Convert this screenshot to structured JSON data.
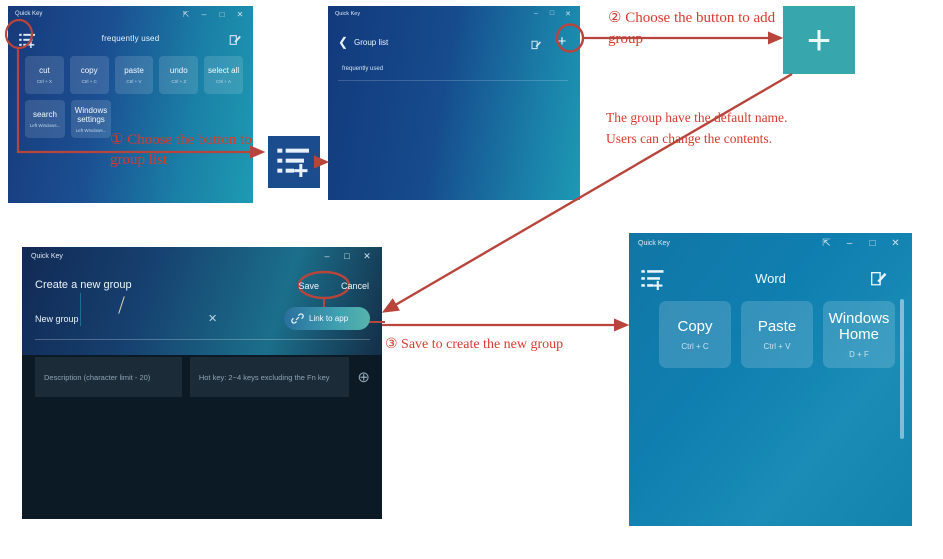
{
  "app": {
    "name": "Quick Key",
    "accent_red": "#d83a2e",
    "teal": "#38a6ad",
    "dark_blue": "#1b4d8e"
  },
  "titlebar": {
    "title": "Quick Key",
    "pin_icon": "pin-icon",
    "minimize": "–",
    "maximize": "□",
    "close": "✕"
  },
  "window_home": {
    "title": "frequently used",
    "group_list_icon": "list-plus-icon",
    "edit_icon": "edit-pencil-icon",
    "tiles_row1": [
      {
        "label": "cut",
        "shortcut": "Ctrl + X"
      },
      {
        "label": "copy",
        "shortcut": "Ctrl + C"
      },
      {
        "label": "paste",
        "shortcut": "Ctrl + V"
      },
      {
        "label": "undo",
        "shortcut": "Ctrl + Z"
      },
      {
        "label": "select all",
        "shortcut": "Ctrl + A"
      }
    ],
    "tiles_row2": [
      {
        "label": "search",
        "shortcut": "Left Windows..."
      },
      {
        "label": "Windows settings",
        "shortcut": "Left Windows..."
      }
    ]
  },
  "window_group_list": {
    "back_icon": "chevron-left-icon",
    "title": "Group list",
    "edit_icon": "edit-pencil-icon",
    "add_icon": "plus-icon",
    "add_glyph": "+",
    "items": [
      "frequently used"
    ]
  },
  "callout_plus": {
    "glyph": "+",
    "icon": "plus-icon"
  },
  "callout_listplus": {
    "icon": "list-plus-icon"
  },
  "window_create_group": {
    "heading": "Create a new group",
    "save_label": "Save",
    "cancel_label": "Cancel",
    "name_value": "New group",
    "clear_glyph": "✕",
    "link_label": "Link to app",
    "link_icon": "link-chain-icon",
    "description_placeholder": "Description (character limit - 20)",
    "hotkey_placeholder": "Hot key: 2~4 keys excluding the Fn key",
    "add_key_glyph": "⊕"
  },
  "window_word": {
    "group_list_icon": "list-plus-icon",
    "title": "Word",
    "edit_icon": "edit-pencil-icon",
    "tiles": [
      {
        "label": "Copy",
        "shortcut": "Ctrl + C"
      },
      {
        "label": "Paste",
        "shortcut": "Ctrl + V"
      },
      {
        "label": "Windows Home",
        "shortcut": "D + F"
      }
    ]
  },
  "annotations": {
    "step1": "① Choose the button to group list",
    "step2": "② Choose the button to add group",
    "note": "The group have the default name. Users can change the contents.",
    "step3": "③ Save to create the new group"
  }
}
